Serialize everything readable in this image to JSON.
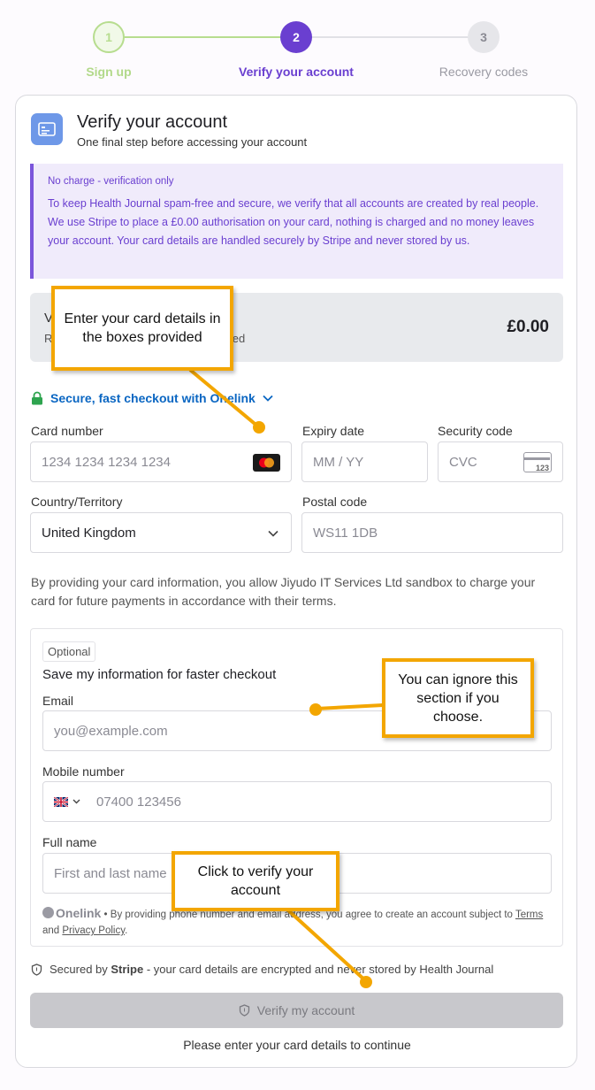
{
  "stepper": {
    "steps": [
      {
        "number": "1",
        "label": "Sign up"
      },
      {
        "number": "2",
        "label": "Verify your account"
      },
      {
        "number": "3",
        "label": "Recovery codes"
      }
    ]
  },
  "header": {
    "icon": "credit-card-icon",
    "title": "Verify your account",
    "subtitle": "One final step before accessing your account"
  },
  "notice": {
    "title": "No charge - verification only",
    "body": "To keep Health Journal spam-free and secure, we verify that all accounts are created by real people. We use Stripe to place a £0.00 authorisation on your card, nothing is charged and no money leaves your account. Your card details are handled securely by Stripe and never stored by us."
  },
  "summary": {
    "label_fragment": "V",
    "sub_fragment": "R",
    "sub_tail": "arged",
    "amount": "£0.00"
  },
  "onelink": {
    "label": "Secure, fast checkout with Onelink"
  },
  "payment": {
    "card_number_label": "Card number",
    "card_number_placeholder": "1234 1234 1234 1234",
    "expiry_label": "Expiry date",
    "expiry_placeholder": "MM / YY",
    "cvc_label": "Security code",
    "cvc_placeholder": "CVC",
    "cvc_icon_text": "123",
    "country_label": "Country/Territory",
    "country_value": "United Kingdom",
    "postal_label": "Postal code",
    "postal_placeholder": "WS11 1DB"
  },
  "consent": "By providing your card information, you allow Jiyudo IT Services Ltd sandbox to charge your card for future payments in accordance with their terms.",
  "optional": {
    "tag": "Optional",
    "title": "Save my information for faster checkout",
    "email_label": "Email",
    "email_placeholder": "you@example.com",
    "mobile_label": "Mobile number",
    "mobile_placeholder": "07400 123456",
    "name_label": "Full name",
    "name_placeholder": "First and last name",
    "footer_brand": "Onelink",
    "footer_text": " • By providing phone number and email address, you agree to create an account subject to ",
    "terms_link": "Terms",
    "and_text": " and ",
    "privacy_link": "Privacy Policy",
    "period": "."
  },
  "secured": {
    "prefix": "Secured by ",
    "brand": "Stripe",
    "suffix": " - your card details are encrypted and never stored by Health Journal"
  },
  "verify_button": "Verify my account",
  "help_text": "Please enter your card details to continue",
  "callouts": {
    "card": "Enter your card details in the boxes provided",
    "optional": "You can ignore this section if you choose.",
    "verify": "Click to verify your account"
  },
  "colors": {
    "accent": "#6a3fd0",
    "done": "#b7dd8f",
    "callout": "#f3a600",
    "link": "#0a66c2"
  }
}
